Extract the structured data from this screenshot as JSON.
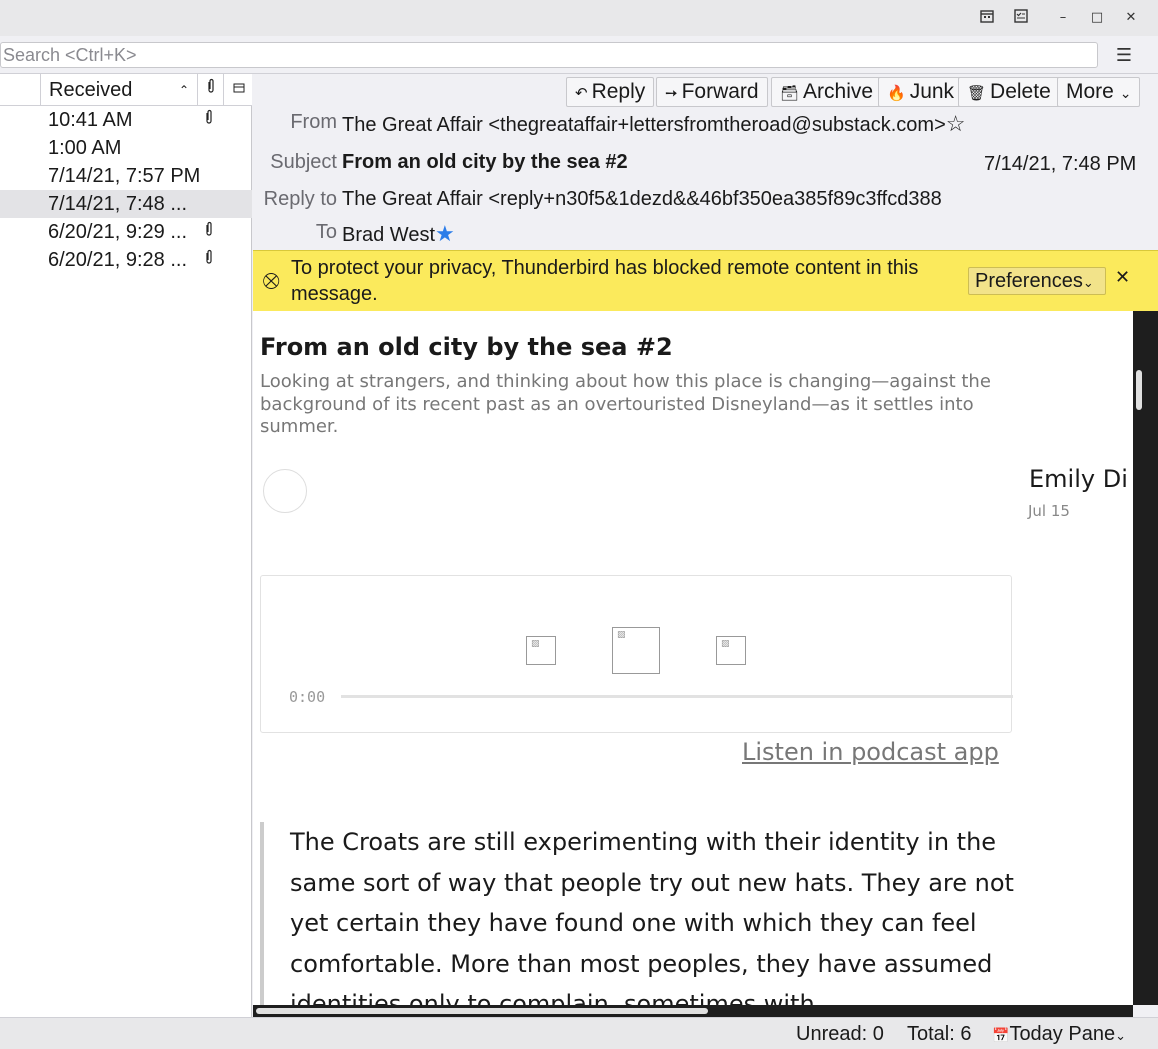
{
  "titlebar": {
    "icons": [
      "calendar-icon",
      "tasks-icon",
      "minimize-icon",
      "restore-icon",
      "close-icon"
    ],
    "minimize": "–",
    "restore": "□",
    "close": "✕"
  },
  "search": {
    "placeholder": "Search <Ctrl+K>",
    "menu_icon": "☰"
  },
  "thread_pane": {
    "column_received": "Received",
    "sort_indicator": "⌃",
    "attach_col_icon": "📎",
    "picker_icon": "⊟",
    "rows": [
      {
        "date": "10:41 AM",
        "attachment": true,
        "selected": false
      },
      {
        "date": "1:00 AM",
        "attachment": false,
        "selected": false
      },
      {
        "date": "7/14/21, 7:57 PM",
        "attachment": false,
        "selected": false
      },
      {
        "date": "7/14/21, 7:48 ...",
        "attachment": false,
        "selected": true
      },
      {
        "date": "6/20/21, 9:29 ...",
        "attachment": true,
        "selected": false
      },
      {
        "date": "6/20/21, 9:28 ...",
        "attachment": true,
        "selected": false
      }
    ]
  },
  "header": {
    "buttons": {
      "reply": "Reply",
      "reply_icon": "↶",
      "forward": "Forward",
      "forward_icon": "➙",
      "archive": "Archive",
      "archive_icon": "🗃",
      "junk": "Junk",
      "junk_icon": "🔥",
      "delete": "Delete",
      "delete_icon": "🗑",
      "more": "More",
      "more_icon": "⌄"
    },
    "from_label": "From",
    "from_value": "The Great Affair <thegreataffair+lettersfromtheroad@substack.com>",
    "subject_label": "Subject",
    "subject_value": "From an old city by the sea #2",
    "date": "7/14/21, 7:48 PM",
    "replyto_label": "Reply to",
    "replyto_value": "The Great Affair <reply+n30f5&1dezd&&46bf350ea385f89c3ffcd388",
    "to_label": "To",
    "to_value": "Brad West",
    "star_empty": "☆",
    "star_filled": "★"
  },
  "notification": {
    "text": "To protect your privacy, Thunderbird has blocked remote content in this message.",
    "icon": "⛒",
    "preferences": "Preferences",
    "pref_chevron": "⌄",
    "close": "✕"
  },
  "article": {
    "title": "From an old city by the sea #2",
    "subtitle": "Looking at strangers, and thinking about how this place is changing—against the background of its recent past as an overtouristed Disneyland—as it settles into summer.",
    "author": "Emily Di",
    "date": "Jul 15",
    "player_time": "0:00",
    "listen_link": "Listen in podcast app",
    "quote": "The Croats are still experimenting with their identity in the same sort of way that people try out new hats. They are not yet certain they have found one with which they can feel comfortable. More than most peoples, they have assumed identities only to complain, sometimes with"
  },
  "statusbar": {
    "unread": "Unread: 0",
    "total": "Total: 6",
    "today_pane": "Today Pane",
    "today_icon": "📅",
    "chevron": "⌄"
  }
}
